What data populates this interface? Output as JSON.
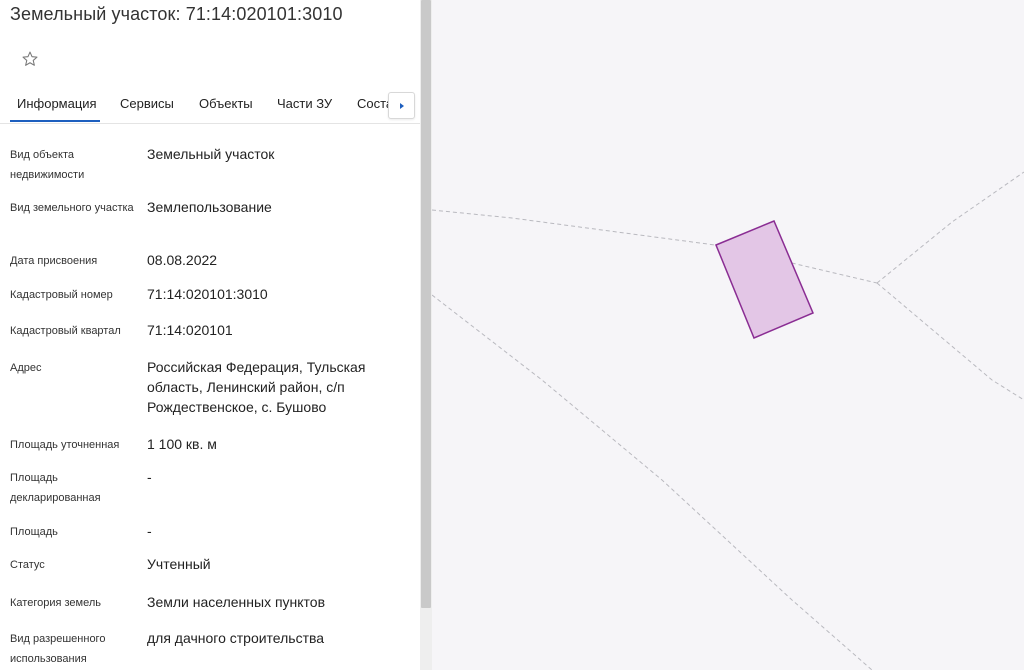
{
  "header": {
    "title": "Земельный участок: 71:14:020101:3010",
    "favorite_icon": "star-icon"
  },
  "tabs": [
    {
      "label": "Информация",
      "active": true
    },
    {
      "label": "Сервисы"
    },
    {
      "label": "Объекты"
    },
    {
      "label": "Части ЗУ"
    },
    {
      "label": "Состав"
    }
  ],
  "tabs_next_icon": "chevron-right-icon",
  "info": [
    {
      "label": "Вид объекта недвижимости",
      "value": "Земельный участок"
    },
    {
      "label": "Вид земельного участка",
      "value": "Землепользование"
    },
    {
      "label": "Дата присвоения",
      "value": "08.08.2022"
    },
    {
      "label": "Кадастровый номер",
      "value": "71:14:020101:3010"
    },
    {
      "label": "Кадастровый квартал",
      "value": "71:14:020101"
    },
    {
      "label": "Адрес",
      "value": "Российская Федерация, Тульская область, Ленинский район, с/п Рождественское, с. Бушово"
    },
    {
      "label": "Площадь уточненная",
      "value": "1 100 кв. м"
    },
    {
      "label": "Площадь декларированная",
      "value": "-"
    },
    {
      "label": "Площадь",
      "value": "-"
    },
    {
      "label": "Статус",
      "value": "Учтенный"
    },
    {
      "label": "Категория земель",
      "value": "Земли населенных пунктов"
    },
    {
      "label": "Вид разрешенного использования",
      "value": "для дачного строительства"
    }
  ],
  "colors": {
    "accent": "#1d5fbf",
    "parcel_fill": "#e3c6e6",
    "parcel_stroke": "#8a2d93",
    "boundary": "#b9b9bf"
  }
}
